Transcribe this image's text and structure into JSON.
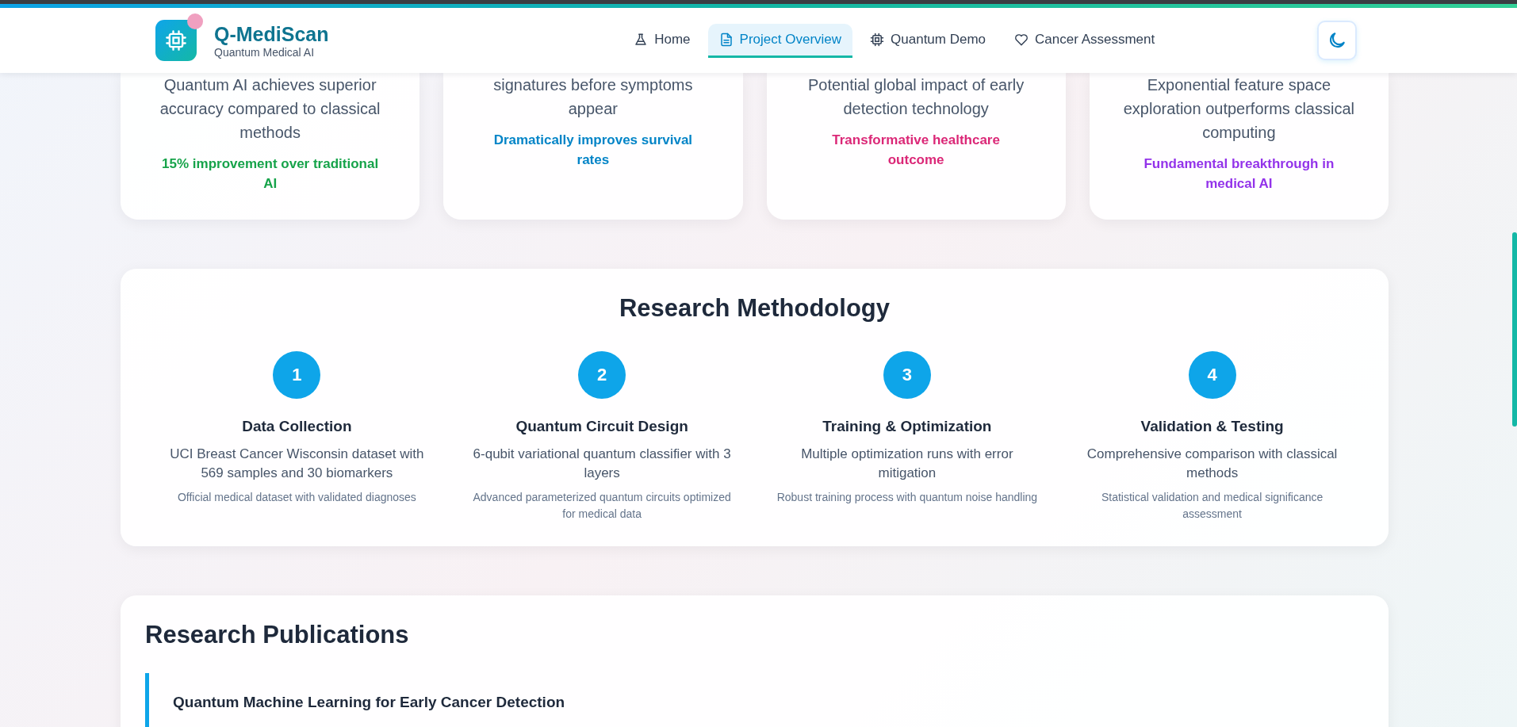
{
  "header": {
    "brand": "Q-MediScan",
    "tagline": "Quantum Medical AI",
    "nav": [
      {
        "label": "Home",
        "selected": false
      },
      {
        "label": "Project Overview",
        "selected": true
      },
      {
        "label": "Quantum Demo",
        "selected": false
      },
      {
        "label": "Cancer Assessment",
        "selected": false
      }
    ]
  },
  "stat_cards": [
    {
      "description": "Quantum AI achieves superior accuracy compared to classical methods",
      "highlight": "15% improvement over traditional AI",
      "color": "#16a34a"
    },
    {
      "description": "signatures before symptoms appear",
      "highlight": "Dramatically improves survival rates",
      "color": "#0284c7"
    },
    {
      "description": "Potential global impact of early detection technology",
      "highlight": "Transformative healthcare outcome",
      "color": "#db2777"
    },
    {
      "description": "Exponential feature space exploration outperforms classical computing",
      "highlight": "Fundamental breakthrough in medical AI",
      "color": "#9333ea"
    }
  ],
  "methodology": {
    "title": "Research Methodology",
    "steps": [
      {
        "number": "1",
        "title": "Data Collection",
        "description": "UCI Breast Cancer Wisconsin dataset with 569 samples and 30 biomarkers",
        "note": "Official medical dataset with validated diagnoses"
      },
      {
        "number": "2",
        "title": "Quantum Circuit Design",
        "description": "6-qubit variational quantum classifier with 3 layers",
        "note": "Advanced parameterized quantum circuits optimized for medical data"
      },
      {
        "number": "3",
        "title": "Training & Optimization",
        "description": "Multiple optimization runs with error mitigation",
        "note": "Robust training process with quantum noise handling"
      },
      {
        "number": "4",
        "title": "Validation & Testing",
        "description": "Comprehensive comparison with classical methods",
        "note": "Statistical validation and medical significance assessment"
      }
    ]
  },
  "publications": {
    "title": "Research Publications",
    "items": [
      {
        "title": "Quantum Machine Learning for Early Cancer Detection"
      }
    ]
  }
}
